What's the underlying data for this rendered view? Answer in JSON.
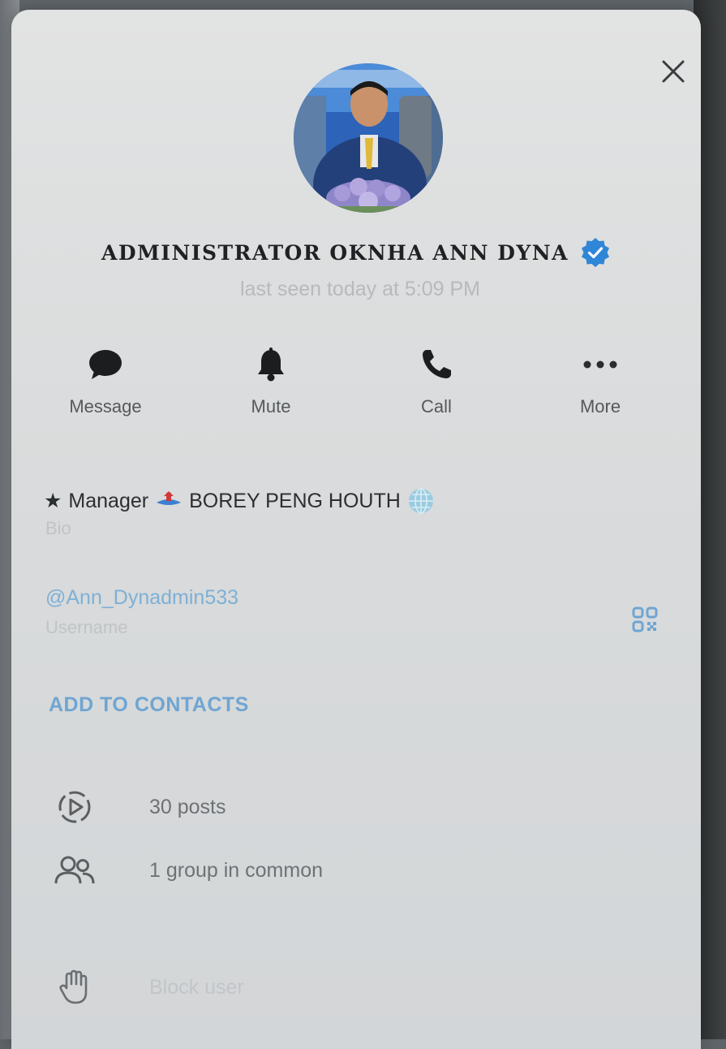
{
  "profile": {
    "name": "ADMINISTRATOR OKNHA ANN DYNA",
    "status": "last seen today at 5:09 PM",
    "verified": true,
    "avatar_icon": "profile-photo"
  },
  "actions": [
    {
      "label": "Message",
      "icon": "chat-bubble-icon"
    },
    {
      "label": "Mute",
      "icon": "bell-icon"
    },
    {
      "label": "Call",
      "icon": "phone-icon"
    },
    {
      "label": "More",
      "icon": "ellipsis-icon"
    }
  ],
  "bio": {
    "star": "★",
    "text1": "Manager",
    "text2": "BOREY PENG HOUTH",
    "caption": "Bio"
  },
  "username": {
    "value": "@Ann_Dynadmin533",
    "caption": "Username"
  },
  "add_contacts": "ADD TO CONTACTS",
  "list": {
    "posts": "30 posts",
    "groups": "1 group in common",
    "block": "Block user"
  },
  "colors": {
    "accent": "#6fa5d2",
    "verified": "#2f86d6",
    "panel": "#dcdedf"
  }
}
